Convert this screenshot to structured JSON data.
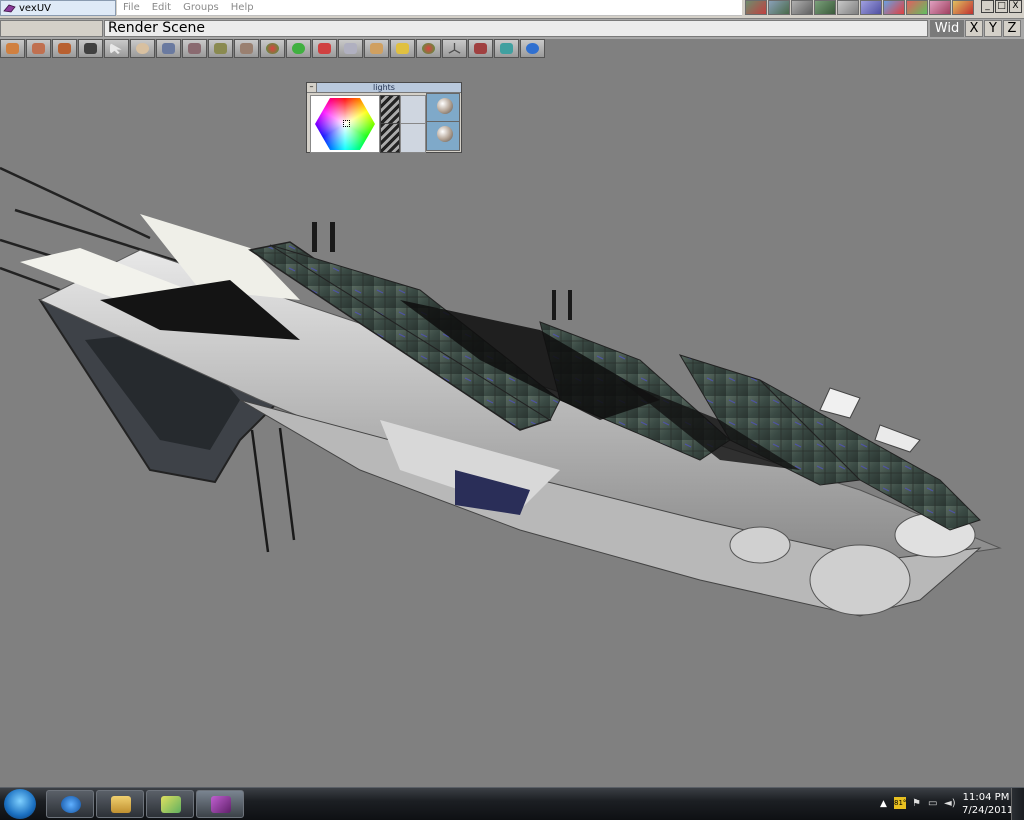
{
  "app": {
    "title": "vexUV"
  },
  "menu": [
    "File",
    "Edit",
    "Groups",
    "Help"
  ],
  "scene_bar": {
    "label": "Render Scene"
  },
  "axis_buttons": [
    "Wid",
    "X",
    "Y",
    "Z"
  ],
  "window_buttons": [
    "_",
    "□",
    "X"
  ],
  "lights_panel": {
    "title": "lights",
    "close": "–"
  },
  "taskbar": {
    "time": "11:04 PM",
    "date": "7/24/2011",
    "tray_badge": "81°"
  },
  "colors": {
    "viewport_bg": "#808080",
    "ui_gray": "#d4d0c8",
    "accent_blue": "#5050c8"
  },
  "toolbar_icons": [
    "link-tool-icon",
    "move-tool-icon",
    "box-tool-icon",
    "camera-tool-icon",
    "select-arrow-icon",
    "rotate-tool-icon",
    "mesh-tool-icon",
    "plane-tool-icon",
    "texture-tool-icon",
    "material-tool-icon",
    "sphere-tool-icon",
    "blob-tool-icon",
    "paint-tool-icon",
    "curve-tool-icon",
    "stretch-tool-icon",
    "brush-tool-icon",
    "group-tool-icon",
    "axis-tool-icon",
    "bone-tool-icon",
    "uv-tool-icon",
    "3d-view-icon"
  ]
}
